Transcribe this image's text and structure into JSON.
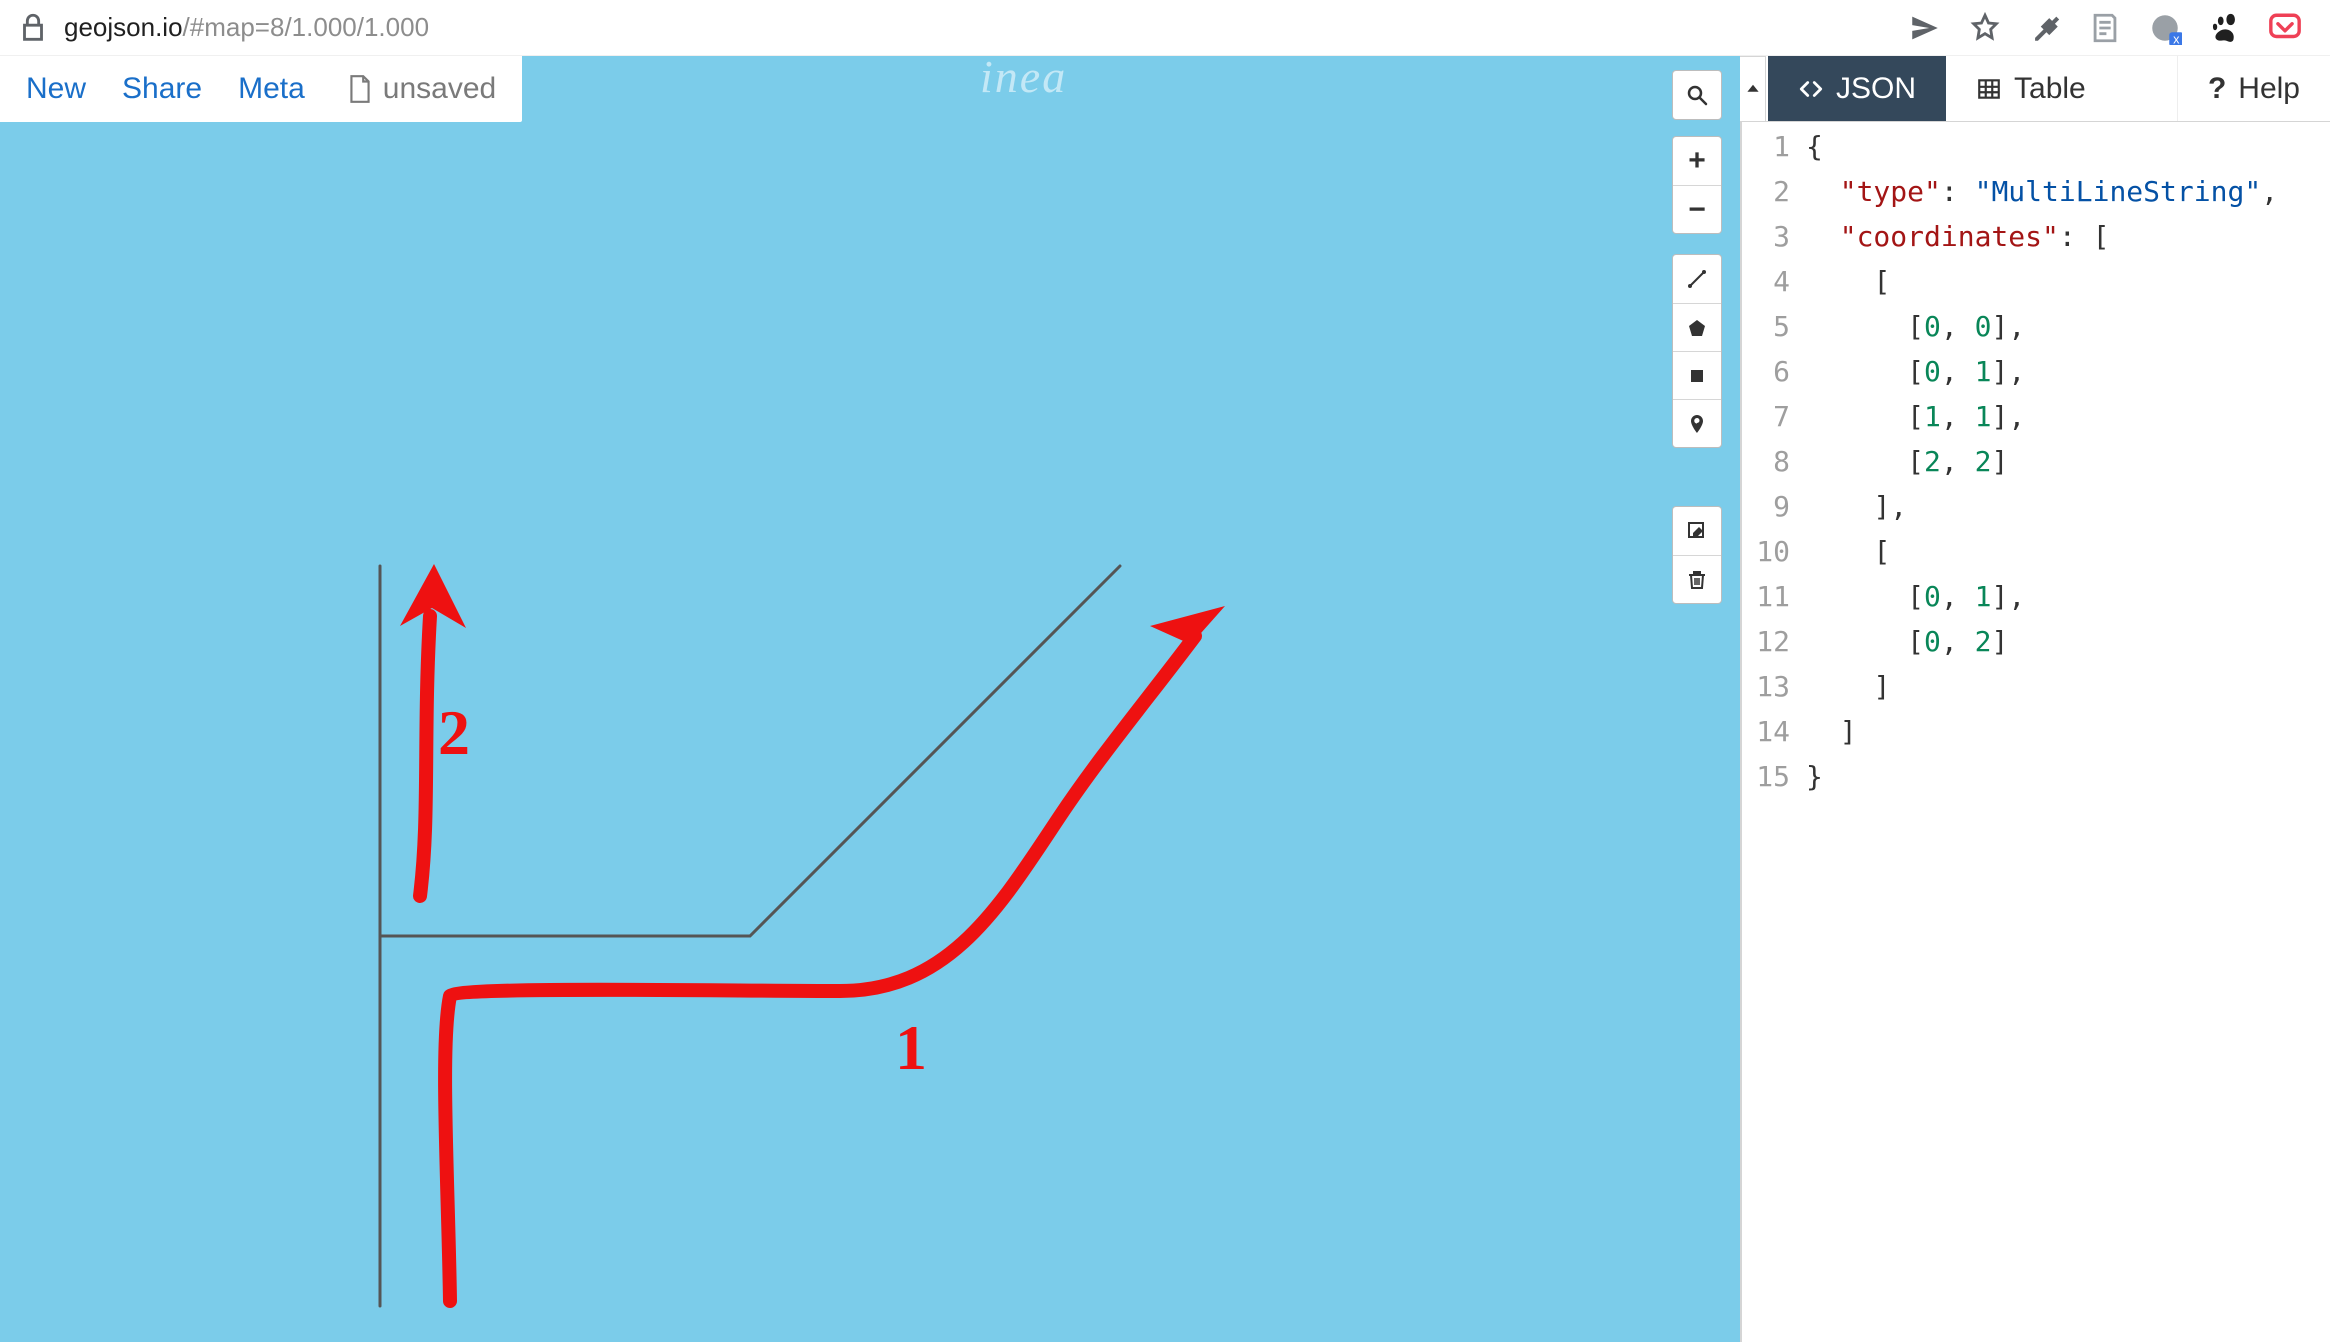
{
  "browser": {
    "url_host": "geojson.io",
    "url_path": "/#map=8/1.000/1.000"
  },
  "menu": {
    "new": "New",
    "share": "Share",
    "meta": "Meta",
    "unsaved": "unsaved"
  },
  "map": {
    "watermark": "inea",
    "controls": {
      "zoom_in": "+",
      "zoom_out": "−"
    },
    "annotations": {
      "label1": "1",
      "label2": "2"
    }
  },
  "right_panel": {
    "tabs": {
      "json": "JSON",
      "table": "Table",
      "help": "Help"
    },
    "geojson": {
      "type": "MultiLineString",
      "coordinates": [
        [
          [
            0,
            0
          ],
          [
            0,
            1
          ],
          [
            1,
            1
          ],
          [
            2,
            2
          ]
        ],
        [
          [
            0,
            1
          ],
          [
            0,
            2
          ]
        ]
      ]
    },
    "code_lines_count": 15,
    "code_render": [
      "{",
      "  \"type\": \"MultiLineString\",",
      "  \"coordinates\": [",
      "    [",
      "      [0, 0],",
      "      [0, 1],",
      "      [1, 1],",
      "      [2, 2]",
      "    ],",
      "    [",
      "      [0, 1],",
      "      [0, 2]",
      "    ]",
      "  ]",
      "}"
    ]
  }
}
